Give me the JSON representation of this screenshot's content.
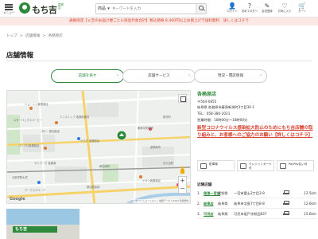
{
  "header": {
    "menu_label": "メニュー",
    "logo_text": "もち吉",
    "logo_small": "直営店",
    "search": {
      "category": "商品",
      "placeholder": "キーワードを入力",
      "caret": "▼"
    },
    "icons": [
      {
        "name": "login",
        "glyph": "👤",
        "label": "ログイン"
      },
      {
        "name": "first-guide",
        "glyph": "?",
        "label": "初めての方へ"
      },
      {
        "name": "registration",
        "glyph": "✎",
        "label": "会員登録"
      },
      {
        "name": "favorites",
        "glyph": "♡",
        "label": "お気に入り"
      },
      {
        "name": "cart",
        "glyph": "🛒",
        "label": "カート"
      }
    ]
  },
  "notice": "通販限定【ｅ吉のお届け便ごとに商品代金合計】税込価格 8,460円以上お買上げで送料無料　詳しくはコチラ",
  "breadcrumb": [
    "トップ",
    ">",
    "店舗情報",
    ">",
    "各務原店"
  ],
  "page_title": "店舗情報",
  "tabs": [
    {
      "label": "店舗を探す",
      "active": true
    },
    {
      "label": "店舗サービス",
      "active": false
    },
    {
      "label": "現況・閉店情報",
      "active": false
    }
  ],
  "map": {
    "labels": [
      "ジョーシン各務原店",
      "スターバックスコーヒー",
      "ミニストップ 各務原那加",
      "パロー 那加西店",
      "ヤマダ 各務原店",
      "ユニクロ各務原店",
      "新村町",
      "各務原市",
      "東海中央病院",
      "サンワーク 各務原",
      "中部学院大学",
      "那加本町",
      "ワークスグループ",
      "イオン各務原店",
      "日の出町",
      "那加新加納"
    ],
    "google": "Google",
    "attribution": "キーボード ショートカット 地図データ ©2022 利用規約"
  },
  "photo_sign": "もち吉",
  "info": {
    "store_name": "各務原店",
    "zip": "〒504-0855",
    "address": "岐阜県 各務原市蘇原新栄町3丁目30-1",
    "tel": "TEL：058-380-2031",
    "hours": "営業時間：10時00分～18時00分",
    "alert": "新型コロナウイルス感染拡大防止のためにもち吉店舗の取り組みと、お客様へのご協力のお願い【詳しくはコチラ】",
    "services": [
      {
        "label": "駐車場"
      },
      {
        "label": "クレジットカード可"
      },
      {
        "label": "PayPay払い可"
      }
    ],
    "nearby_title": "近隣店舗",
    "nearby": [
      {
        "no": "1.",
        "name": "尾張一宮店",
        "pref": "愛知県",
        "address": "一宮市富士2丁目3-9",
        "distance": "12.5km"
      },
      {
        "no": "2.",
        "name": "岐阜店",
        "pref": "岐阜県",
        "address": "岐阜市北島7丁目8-8",
        "distance": "12.6km"
      },
      {
        "no": "3.",
        "name": "可児店",
        "pref": "岐阜県",
        "address": "可児市坂戸字前田837",
        "distance": "15.6km"
      }
    ]
  },
  "colors": {
    "brand_green": "#2d8a3c",
    "alert_red": "#d9432f",
    "notice_bg": "#fbe8e4"
  }
}
